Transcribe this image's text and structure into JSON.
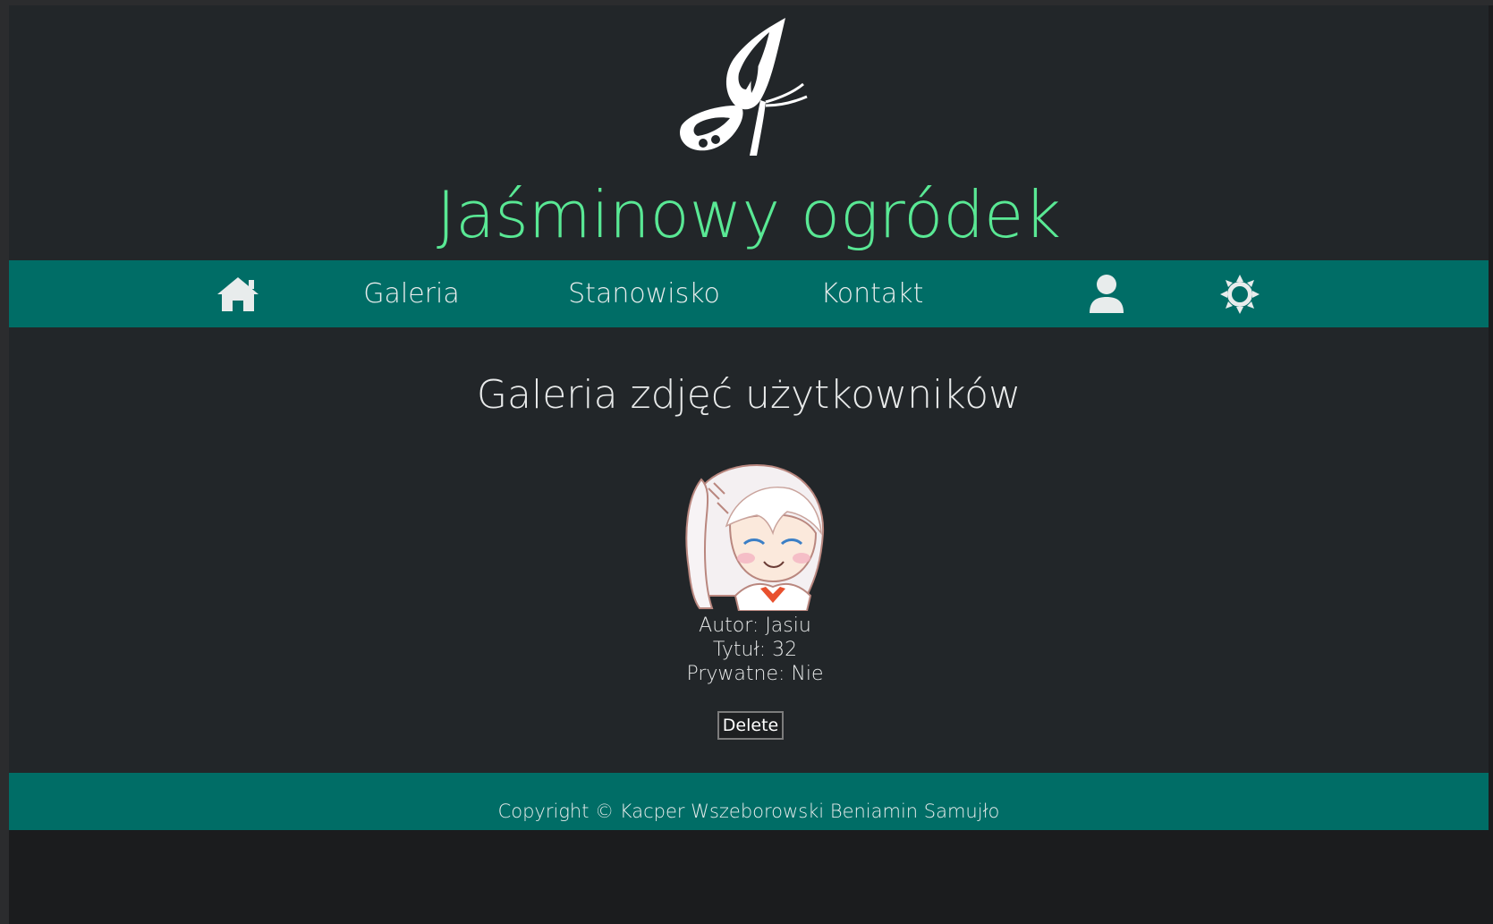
{
  "header": {
    "logo_icon": "butterfly-logo",
    "site_title": "Jaśminowy ogródek"
  },
  "nav": {
    "home_icon": "home-icon",
    "items": [
      {
        "label": "Galeria"
      },
      {
        "label": "Stanowisko"
      },
      {
        "label": "Kontakt"
      }
    ],
    "user_icon": "user-icon",
    "theme_icon": "sun-icon"
  },
  "main": {
    "heading": "Galeria zdjęć użytkowników",
    "photos": [
      {
        "image": "anime-girl-thumbnail",
        "author_line": "Autor: Jasiu",
        "title_line": "Tytuł: 32",
        "private_line": "Prywatne: Nie",
        "delete_label": "Delete"
      }
    ]
  },
  "footer": {
    "copyright": "Copyright © Kacper Wszeborowski Beniamin Samujło"
  },
  "colors": {
    "accent_green": "#59e894",
    "teal_bar": "#006d66",
    "content_bg": "#222629",
    "page_bg": "#1b1c1e"
  }
}
